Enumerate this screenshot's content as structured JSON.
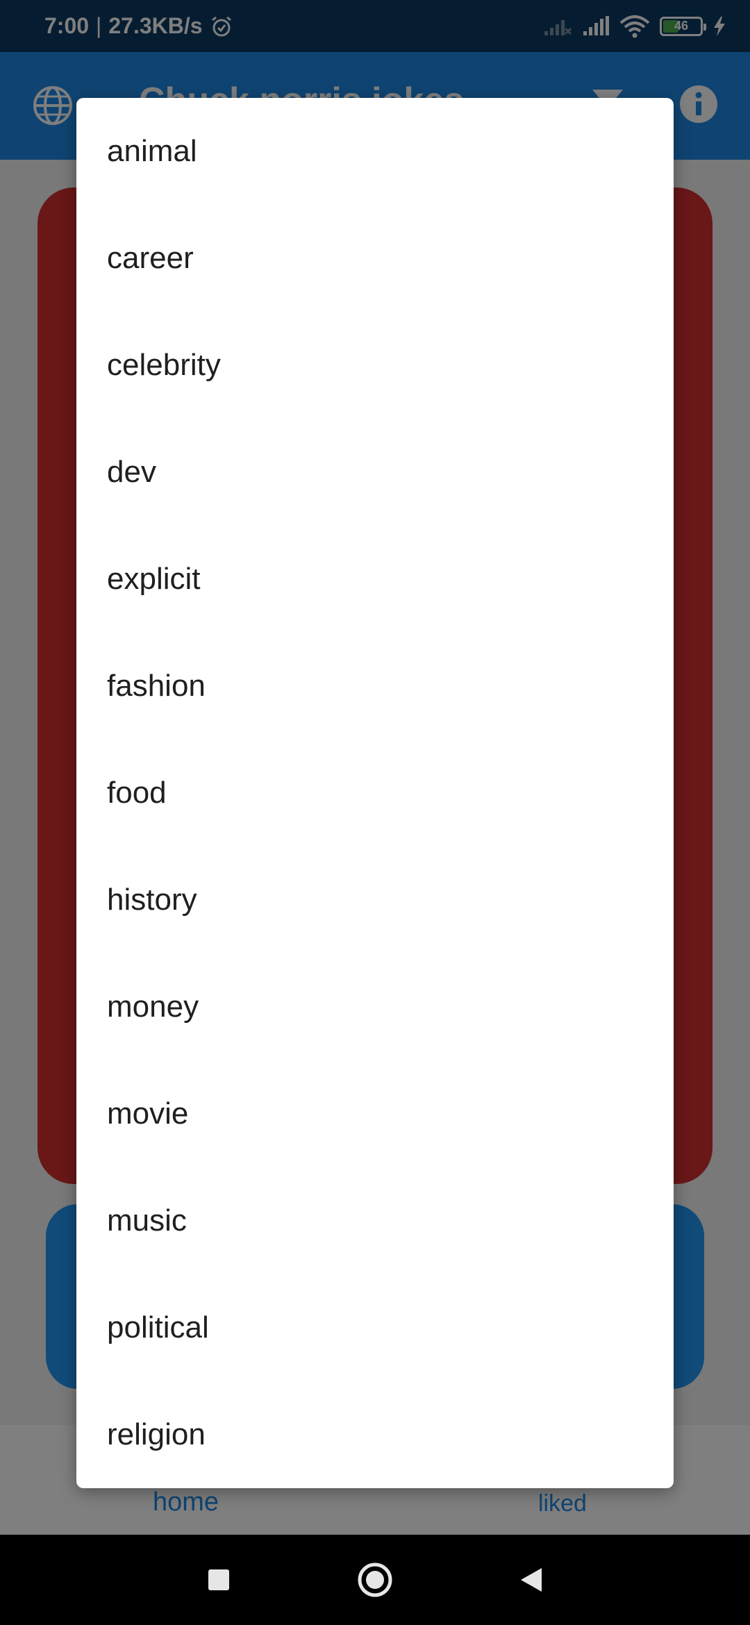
{
  "status_bar": {
    "time": "7:00",
    "separator": "|",
    "net_speed": "27.3KB/s",
    "battery_level": "46",
    "battery_fraction": 0.46,
    "icons": [
      "alarm-icon",
      "signal-weak-icon",
      "signal-icon",
      "wifi-icon",
      "battery-icon",
      "charging-icon"
    ]
  },
  "app_bar": {
    "title": "Chuck norris jokes",
    "icons": [
      "globe-icon",
      "filter-icon",
      "info-icon"
    ],
    "color": "#1e88e5"
  },
  "bottom_nav": {
    "home": "home",
    "liked": "liked"
  },
  "menu": {
    "items": [
      "animal",
      "career",
      "celebrity",
      "dev",
      "explicit",
      "fashion",
      "food",
      "history",
      "money",
      "movie",
      "music",
      "political",
      "religion"
    ]
  },
  "system_nav": {
    "icons": [
      "recent-apps-icon",
      "home-circle-icon",
      "back-triangle-icon"
    ]
  },
  "colors": {
    "card": "#d32f2f",
    "button": "#2196f3",
    "status_bar": "#0d3a63",
    "battery_fill": "#4caf50"
  }
}
